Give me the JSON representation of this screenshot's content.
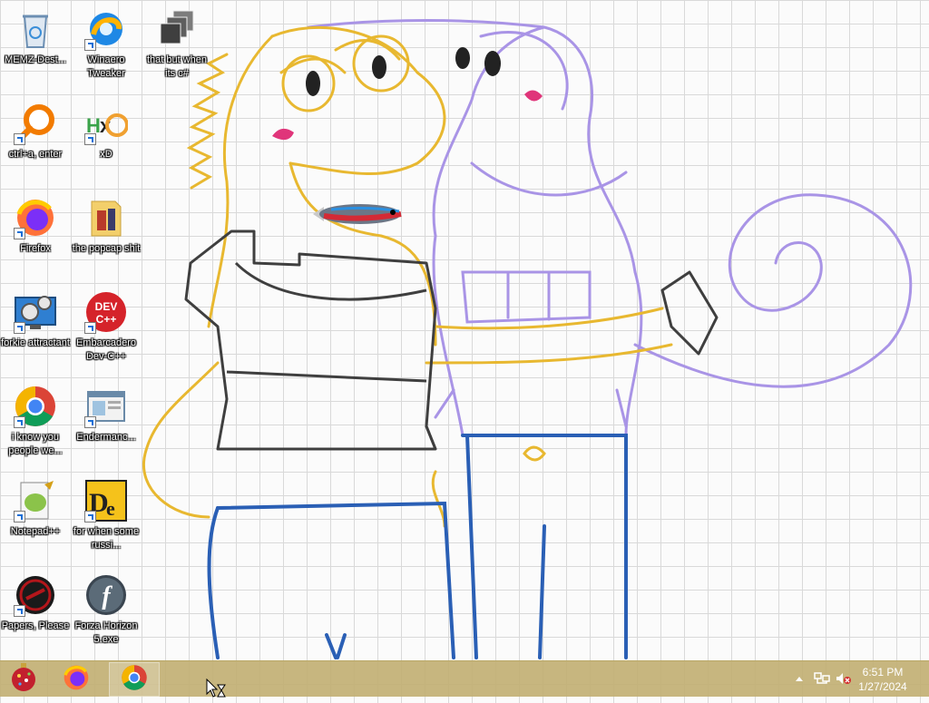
{
  "desktop": {
    "icons": [
      {
        "label": "MEMZ-Dest...",
        "icon": "recycle-bin-icon"
      },
      {
        "label": "Winaero Tweaker",
        "icon": "winaero-tweaker-icon"
      },
      {
        "label": "that but when its c#",
        "icon": "stacked-windows-icon"
      },
      {
        "label": "ctrl+a, enter",
        "icon": "magnifier-app-icon"
      },
      {
        "label": "xD",
        "icon": "hxd-hex-editor-icon"
      },
      {
        "label": "Firefox",
        "icon": "firefox-icon"
      },
      {
        "label": "the popcap shit",
        "icon": "folder-icon"
      },
      {
        "label": "forkie attractant",
        "icon": "monitor-gear-icon"
      },
      {
        "label": "Embarcadero Dev-C++",
        "icon": "dev-cpp-icon"
      },
      {
        "label": "i know you people we...",
        "icon": "chrome-icon"
      },
      {
        "label": "Endermanc...",
        "icon": "window-app-icon"
      },
      {
        "label": "Notepad++",
        "icon": "notepad-plus-plus-icon"
      },
      {
        "label": "for when some russi...",
        "icon": "de-app-icon"
      },
      {
        "label": "Papers, Please",
        "icon": "papers-please-icon"
      },
      {
        "label": "Forza Horizon 5.exe",
        "icon": "flash-icon"
      }
    ]
  },
  "taskbar": {
    "buttons": [
      {
        "icon": "ornament-start-icon"
      },
      {
        "icon": "firefox-icon"
      },
      {
        "icon": "chrome-icon"
      }
    ],
    "tray": {
      "overflow_icon": "chevron-up-icon",
      "network_icon": "network-icon",
      "volume_icon": "volume-muted-icon"
    },
    "clock": {
      "time": "6:51 PM",
      "date": "1/27/2024"
    }
  },
  "colors": {
    "taskbar": "#c2b074",
    "grid_line": "#d9d9d9",
    "lizard_yellow": "#e8b830",
    "lizard_purple": "#a994e6",
    "jeans_blue": "#2a5fb5"
  },
  "wallpaper": {
    "subject": "two-lizards-drawing",
    "fish": "neon-tetra-icon"
  }
}
